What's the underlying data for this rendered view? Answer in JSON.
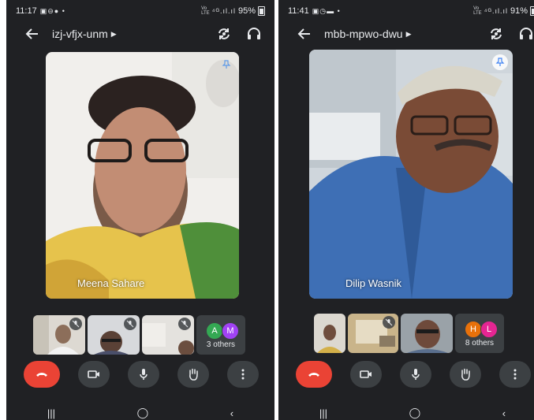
{
  "phones": [
    {
      "status": {
        "time": "11:17",
        "battery": "95%"
      },
      "meeting_code": "izj-vfjx-unm",
      "main_speaker": "Meena Sahare",
      "others": {
        "initials": [
          "A",
          "M"
        ],
        "colors": [
          "#34a853",
          "#a142f4"
        ],
        "label": "3 others"
      }
    },
    {
      "status": {
        "time": "11:41",
        "battery": "91%"
      },
      "meeting_code": "mbb-mpwo-dwu",
      "main_speaker": "Dilip Wasnik",
      "others": {
        "initials": [
          "H",
          "L"
        ],
        "colors": [
          "#e8710a",
          "#e52592"
        ],
        "label": "8 others"
      }
    }
  ],
  "colors": {
    "end_call": "#ea4335",
    "panel": "#202124",
    "chip": "#3c4043"
  }
}
